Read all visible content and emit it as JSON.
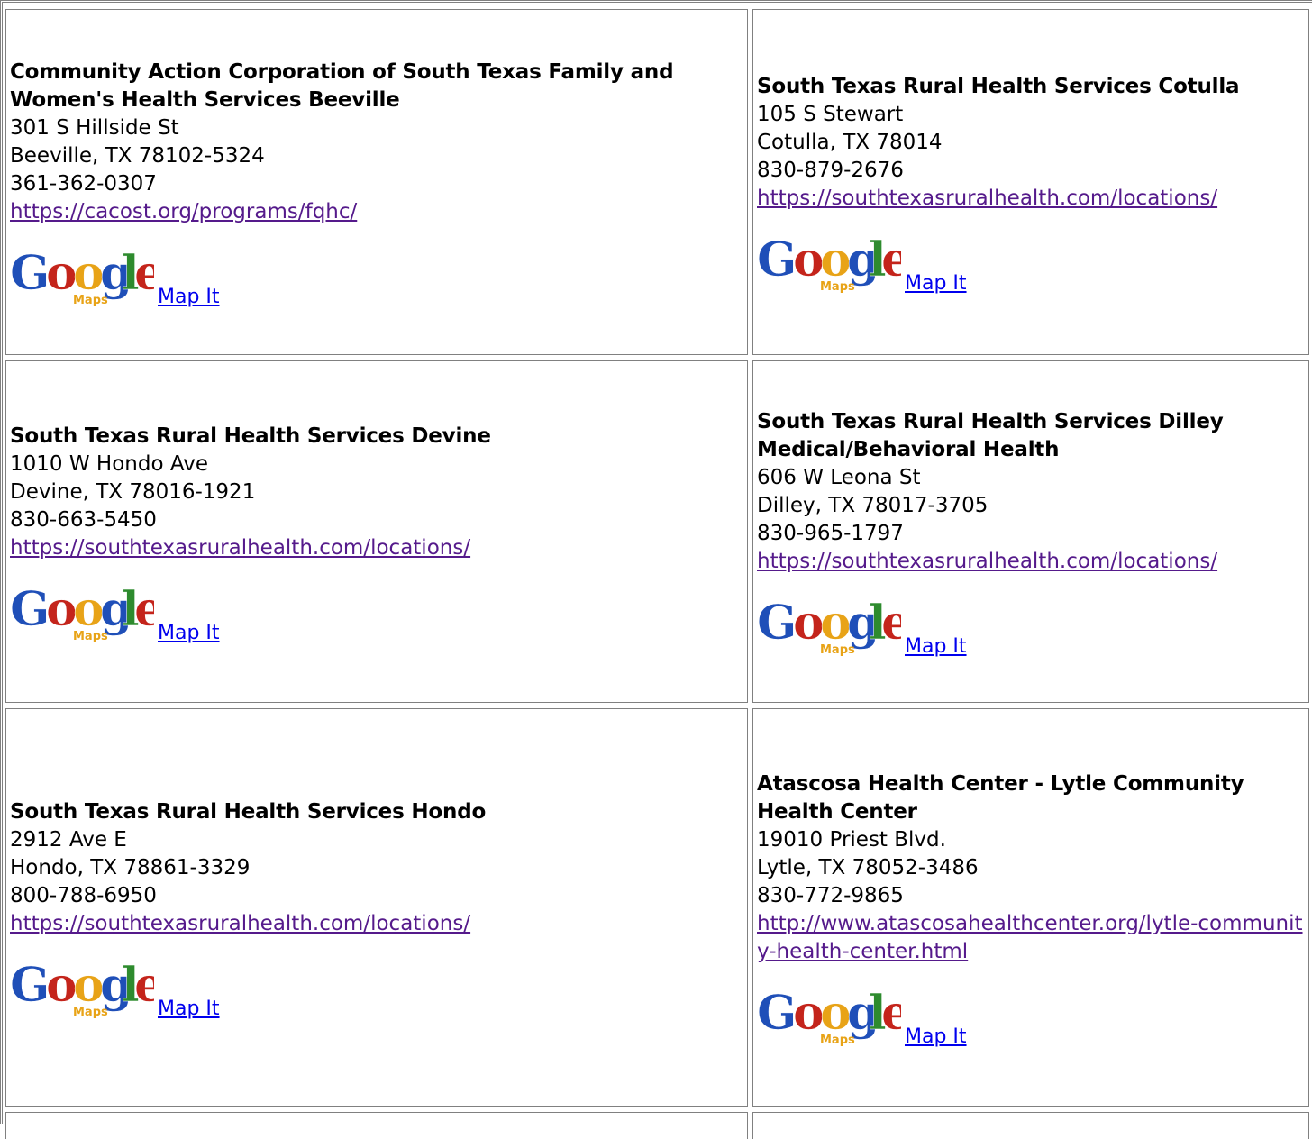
{
  "locations": [
    {
      "name": "Community Action Corporation of South Texas Family and Women's Health Services Beeville",
      "address": "301 S Hillside St",
      "city": "Beeville, TX 78102-5324",
      "phone": "361-362-0307",
      "url": "https://cacost.org/programs/fqhc/",
      "map_label": "Map It"
    },
    {
      "name": "South Texas Rural Health Services Cotulla",
      "address": "105 S Stewart",
      "city": "Cotulla, TX 78014",
      "phone": "830-879-2676",
      "url": "https://southtexasruralhealth.com/locations/",
      "map_label": "Map It"
    },
    {
      "name": "South Texas Rural Health Services Devine",
      "address": "1010 W Hondo Ave",
      "city": "Devine, TX 78016-1921",
      "phone": "830-663-5450",
      "url": "https://southtexasruralhealth.com/locations/",
      "map_label": "Map It"
    },
    {
      "name": "South Texas Rural Health Services Dilley Medical/Behavioral Health",
      "address": "606 W Leona St",
      "city": "Dilley, TX 78017-3705",
      "phone": "830-965-1797",
      "url": "https://southtexasruralhealth.com/locations/",
      "map_label": "Map It"
    },
    {
      "name": "South Texas Rural Health Services Hondo",
      "address": "2912 Ave E",
      "city": "Hondo, TX 78861-3329",
      "phone": "800-788-6950",
      "url": "https://southtexasruralhealth.com/locations/",
      "map_label": "Map It"
    },
    {
      "name": "Atascosa Health Center - Lytle Community Health Center",
      "address": "19010 Priest Blvd.",
      "city": "Lytle, TX 78052-3486",
      "phone": "830-772-9865",
      "url": "http://www.atascosahealthcenter.org/lytle-community-health-center.html",
      "map_label": "Map It"
    }
  ],
  "logo": {
    "wordmark": "Google",
    "sub": "Maps",
    "colors": {
      "blue": "#1f4fb8",
      "red": "#c4241b",
      "yellow": "#e8a317",
      "green": "#2e8b2e",
      "maps_orange": "#e8a317"
    }
  },
  "colors": {
    "link_visited": "#551a8b",
    "link": "#0000ee",
    "border": "#808080"
  }
}
